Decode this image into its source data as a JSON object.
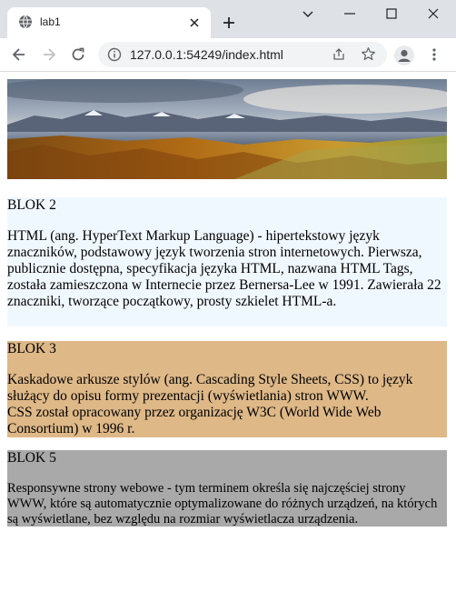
{
  "browser": {
    "tab_title": "lab1",
    "url": "127.0.0.1:54249/index.html",
    "icons": [
      "globe-icon",
      "close-icon",
      "plus-icon",
      "chevron-down-icon",
      "minimize-icon",
      "maximize-icon",
      "window-close-icon",
      "back-icon",
      "forward-icon",
      "reload-icon",
      "info-icon",
      "share-icon",
      "star-icon",
      "profile-icon",
      "kebab-menu-icon"
    ]
  },
  "page": {
    "blocks": [
      {
        "title": "BLOK 2",
        "text": "HTML (ang. HyperText Markup Language) - hipertekstowy język znaczników, podstawowy język tworzenia stron internetowych. Pierwsza, publicznie dostępna, specyfikacja języka HTML, nazwana HTML Tags, została zamieszczona w Internecie przez Bernersa-Lee w 1991. Zawierała 22 znaczniki, tworzące początkowy, prosty szkielet HTML-a.",
        "color": "#f0f8ff"
      },
      {
        "title": "BLOK 3",
        "text": "Kaskadowe arkusze stylów (ang. Cascading Style Sheets, CSS) to język służący do opisu formy prezentacji (wyświetlania) stron WWW.",
        "text2": "CSS został opracowany przez organizację W3C (World Wide Web Consortium) w 1996 r.",
        "color": "#deb887"
      },
      {
        "title": "BLOK 5",
        "text": "Responsywne strony webowe - tym terminem określa się najczęściej strony WWW, które są automatycznie optymalizowane do różnych urządzeń, na których są wyświetlane, bez względu na rozmiar wyświetlacza urządzenia.",
        "color": "#a9a9a9"
      }
    ]
  }
}
